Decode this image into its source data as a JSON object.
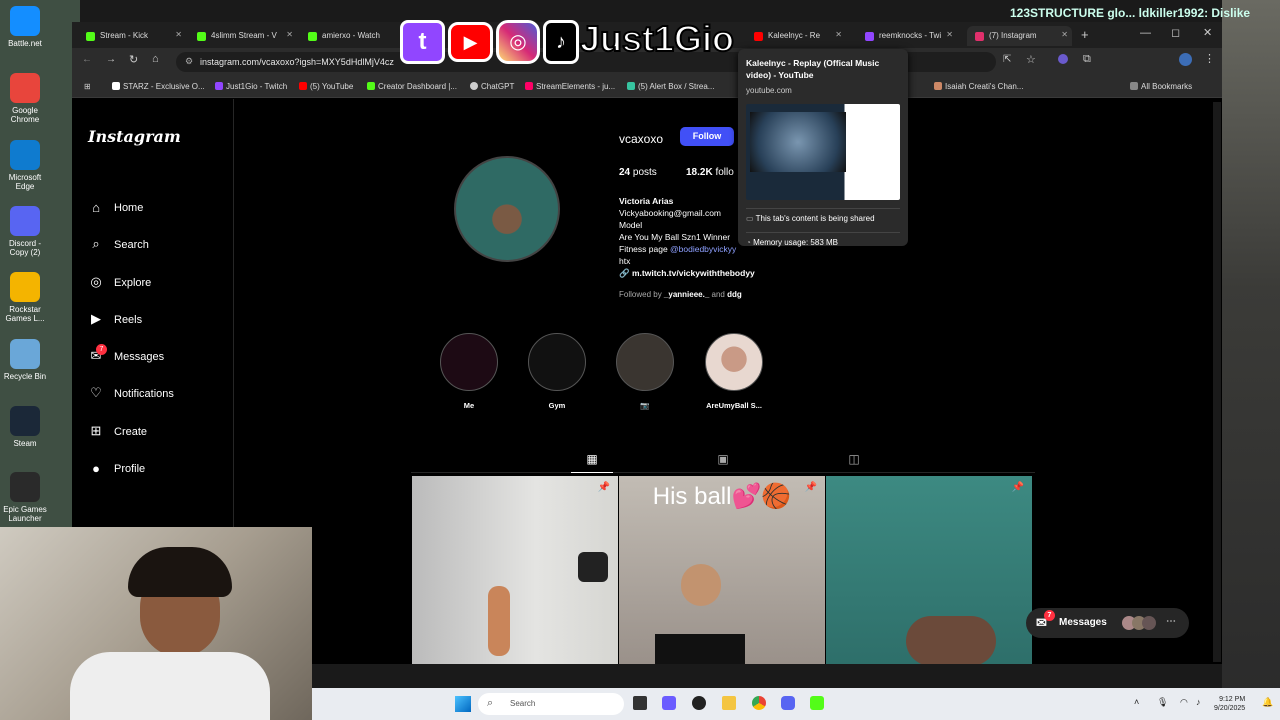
{
  "desktop": {
    "icons": [
      {
        "label": "Battle.net",
        "color": "#148eff"
      },
      {
        "label": "Google Chrome",
        "color": "#e8453c"
      },
      {
        "label": "Microsoft Edge",
        "color": "#0f7bcf"
      },
      {
        "label": "Discord - Copy (2)",
        "color": "#5865f2"
      },
      {
        "label": "Rockstar Games L...",
        "color": "#f4b400"
      },
      {
        "label": "Recycle Bin",
        "color": "#6aa7d8"
      },
      {
        "label": "Steam",
        "color": "#1b2838"
      },
      {
        "label": "Epic Games Launcher",
        "color": "#2a2a2a"
      }
    ]
  },
  "overlay": {
    "channel_name": "Just1Gio",
    "stream_text": "123STRUCTURE glo... ldkiller1992: Dislike"
  },
  "browser": {
    "tabs": [
      {
        "title": "Stream - Kick",
        "color": "#53fc18"
      },
      {
        "title": "4slimm Stream - V",
        "color": "#53fc18"
      },
      {
        "title": "amierxo - Watch",
        "color": "#53fc18"
      },
      {
        "title": "Kaleelnyc - Re",
        "color": "#ff0000"
      },
      {
        "title": "reemknocks - Twi",
        "color": "#9146ff"
      },
      {
        "title": "(7) Instagram",
        "color": "#e1306c"
      }
    ],
    "url": "instagram.com/vcaxoxo?igsh=MXY5dHdlMjV4cz",
    "bookmarks": [
      "STARZ - Exclusive O...",
      "Just1Gio - Twitch",
      "(5) YouTube",
      "Creator Dashboard |...",
      "ChatGPT",
      "StreamElements - ju...",
      "(5) Alert Box / Strea...",
      "Isaiah Creati's Chan..."
    ],
    "all_bookmarks": "All Bookmarks"
  },
  "tooltip": {
    "title": "Kaleelnyc - Replay (Offical Music video) - YouTube",
    "domain": "youtube.com",
    "sharing": "This tab's content is being shared",
    "memory": "Memory usage: 583 MB"
  },
  "instagram": {
    "logo": "Instagram",
    "nav": [
      {
        "label": "Home",
        "icon": "⌂"
      },
      {
        "label": "Search",
        "icon": "⌕"
      },
      {
        "label": "Explore",
        "icon": "◎"
      },
      {
        "label": "Reels",
        "icon": "▶"
      },
      {
        "label": "Messages",
        "icon": "✉",
        "badge": "7"
      },
      {
        "label": "Notifications",
        "icon": "♡"
      },
      {
        "label": "Create",
        "icon": "⊞"
      },
      {
        "label": "Profile",
        "icon": "●"
      }
    ],
    "profile": {
      "username": "vcaxoxo",
      "follow_label": "Follow",
      "posts": "24",
      "posts_label": "posts",
      "followers": "18.2K",
      "followers_label": "follo",
      "bio_name": "Victoria Arias",
      "bio_lines": [
        "Vickyabooking@gmail.com",
        "Model",
        "Are You My Ball Szn1 Winner"
      ],
      "fitness_prefix": "Fitness page ",
      "fitness_link": "@bodiedbyvickyy",
      "location": "htx",
      "link": "m.twitch.tv/vickywiththebodyy",
      "followed_by_prefix": "Followed by ",
      "followed_by_1": "_yannieee._",
      "followed_by_and": " and ",
      "followed_by_2": "ddg"
    },
    "highlights": [
      "Me",
      "Gym",
      "📷",
      "AreUmyBall S..."
    ],
    "post_caption": "His ball💕🏀",
    "messages_label": "Messages",
    "messages_badge": "7"
  },
  "taskbar": {
    "search_placeholder": "Search",
    "time": "9:12 PM",
    "date": "9/20/2025"
  }
}
